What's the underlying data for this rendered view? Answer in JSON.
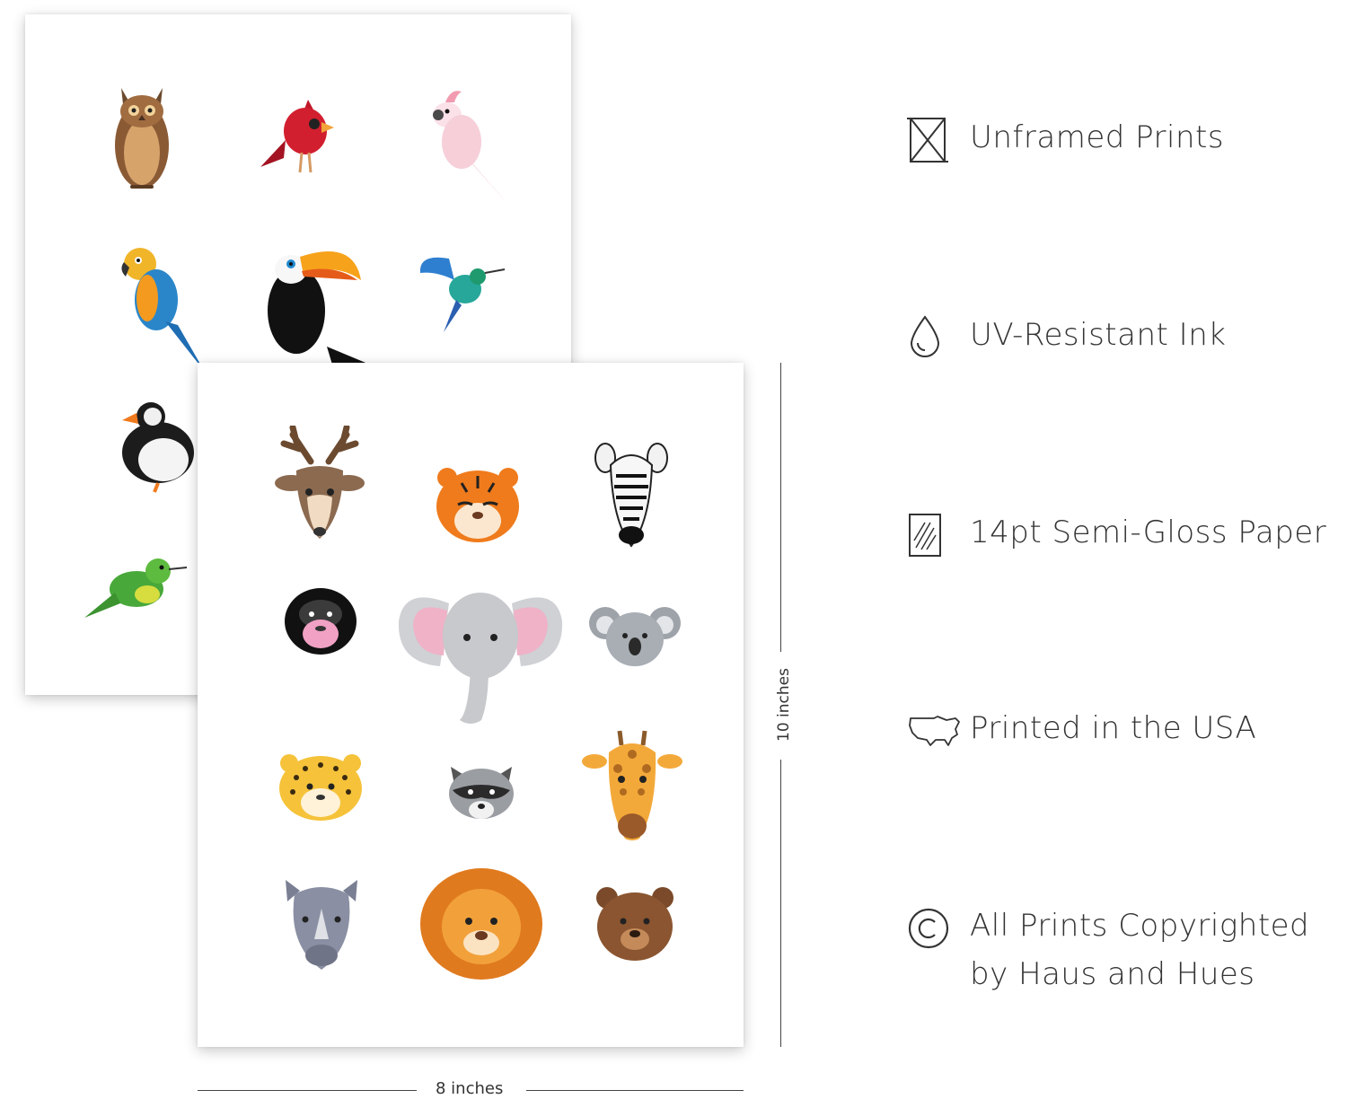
{
  "features": [
    {
      "icon": "unframed-icon",
      "text": "Unframed Prints"
    },
    {
      "icon": "ink-drop-icon",
      "text": "UV-Resistant Ink"
    },
    {
      "icon": "paper-icon",
      "text": "14pt Semi-Gloss Paper"
    },
    {
      "icon": "usa-map-icon",
      "text": "Printed in the USA"
    },
    {
      "icon": "copyright-icon",
      "text": "All Prints Copyrighted",
      "text2": "by Haus and Hues"
    }
  ],
  "dimensions": {
    "width_label": "8 inches",
    "height_label": "10 inches"
  },
  "back_print": {
    "animals": [
      "owl",
      "cardinal",
      "cockatoo",
      "macaw",
      "toucan",
      "hummingbird",
      "puffin",
      "green-bird"
    ]
  },
  "front_print": {
    "animals": [
      "deer",
      "tiger",
      "zebra",
      "gorilla",
      "elephant",
      "koala",
      "leopard",
      "raccoon",
      "giraffe",
      "rhino",
      "lion",
      "bear"
    ]
  }
}
